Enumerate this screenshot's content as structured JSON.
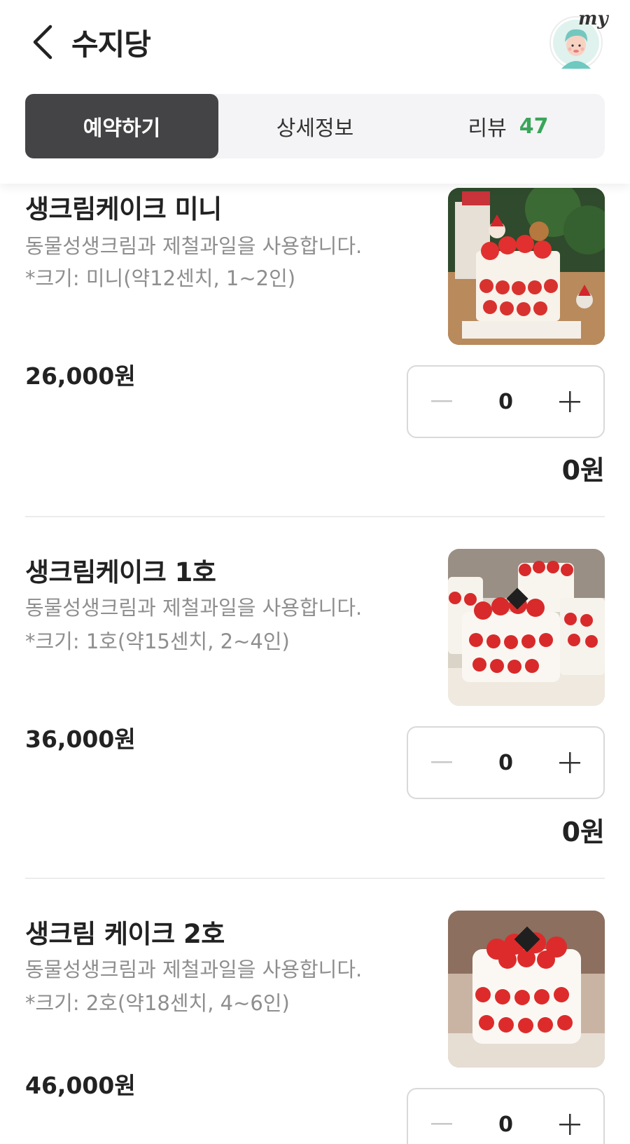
{
  "header": {
    "title": "수지당",
    "my_label": "my"
  },
  "tabs": [
    {
      "label": "예약하기",
      "active": true
    },
    {
      "label": "상세정보",
      "active": false
    },
    {
      "label": "리뷰",
      "count": "47",
      "active": false
    }
  ],
  "products": [
    {
      "name": "생크림케이크 미니",
      "desc": "동물성생크림과 제철과일을 사용합니다.",
      "size": "*크기: 미니(약12센치, 1~2인)",
      "price": "26,000원",
      "quantity": "0",
      "subtotal": "0원",
      "image": "strawberry-cake-christmas-photo"
    },
    {
      "name": "생크림케이크 1호",
      "desc": "동물성생크림과 제철과일을 사용합니다.",
      "size": "*크기: 1호(약15센치, 2~4인)",
      "price": "36,000원",
      "quantity": "0",
      "subtotal": "0원",
      "image": "strawberry-cakes-display-photo"
    },
    {
      "name": "생크림 케이크 2호",
      "desc": "동물성생크림과 제철과일을 사용합니다.",
      "size": "*크기: 2호(약18센치, 4~6인)",
      "price": "46,000원",
      "quantity": "0",
      "subtotal": "",
      "image": "strawberry-cake-2-photo"
    }
  ],
  "colors": {
    "active_tab": "#444446",
    "review_count": "#3aa55a",
    "muted_text": "#8e8e8e"
  }
}
